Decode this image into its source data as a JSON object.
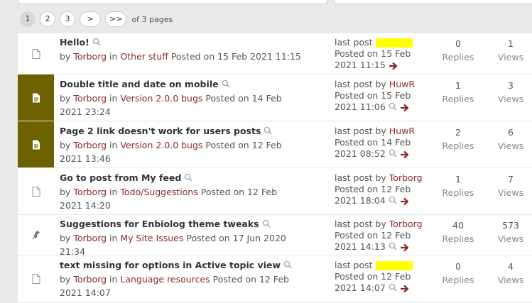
{
  "pagination": {
    "pages": [
      "1",
      "2",
      "3"
    ],
    "next_label": ">",
    "last_label": ">>",
    "info": "of 3 pages"
  },
  "labels": {
    "last_post": "last post",
    "by": "by",
    "in": "in",
    "posted_on": "Posted on",
    "replies": "Replies",
    "views": "Views"
  },
  "colors": {
    "hot_icon_bg": "#6d6100",
    "link": "#8b2a2a",
    "highlight": "#ffff00"
  },
  "topics": [
    {
      "title": "Hello!",
      "author": "Torborg",
      "category": "Other stuff",
      "posted": "15 Feb 2021 11:15",
      "last_by": "",
      "last_line1": "Posted on 15 Feb",
      "last_line2": "2021 11:15",
      "replies": "0",
      "views": "1",
      "icon": "document-icon"
    },
    {
      "title": "Double title and date on mobile",
      "author": "Torborg",
      "category": "Version 2.0.0 bugs",
      "posted": "14 Feb 2021 23:24",
      "last_by": "HuwR",
      "last_line1": "Posted on 15 Feb",
      "last_line2": "2021 11:06",
      "replies": "1",
      "views": "3",
      "icon": "hot-document-icon"
    },
    {
      "title": "Page 2 link doesn't work for users posts",
      "author": "Torborg",
      "category": "Version 2.0.0 bugs",
      "posted": "12 Feb 2021 13:46",
      "last_by": "HuwR",
      "last_line1": "Posted on 14 Feb",
      "last_line2": "2021 08:52",
      "replies": "2",
      "views": "6",
      "icon": "hot-document-icon"
    },
    {
      "title": "Go to post from My feed",
      "author": "Torborg",
      "category": "Todo/Suggestions",
      "posted": "12 Feb 2021 14:20",
      "last_by": "Torborg",
      "last_line1": "Posted on 12 Feb",
      "last_line2": "2021 18:04",
      "replies": "1",
      "views": "7",
      "icon": "document-icon"
    },
    {
      "title": "Suggestions for Enbiolog theme tweaks",
      "author": "Torborg",
      "category": "My Site Issues",
      "posted": "17 Jun 2020 21:34",
      "last_by": "Torborg",
      "last_line1": "Posted on 12 Feb",
      "last_line2": "2021 14:13",
      "replies": "40",
      "views": "573",
      "icon": "pin-icon"
    },
    {
      "title": "text missing for options in Active topic view",
      "author": "Torborg",
      "category": "Language resources",
      "posted": "12 Feb 2021 14:07",
      "last_by": "",
      "last_line1": "Posted on 12 Feb",
      "last_line2": "2021 14:07",
      "replies": "0",
      "views": "4",
      "icon": "document-icon"
    }
  ]
}
